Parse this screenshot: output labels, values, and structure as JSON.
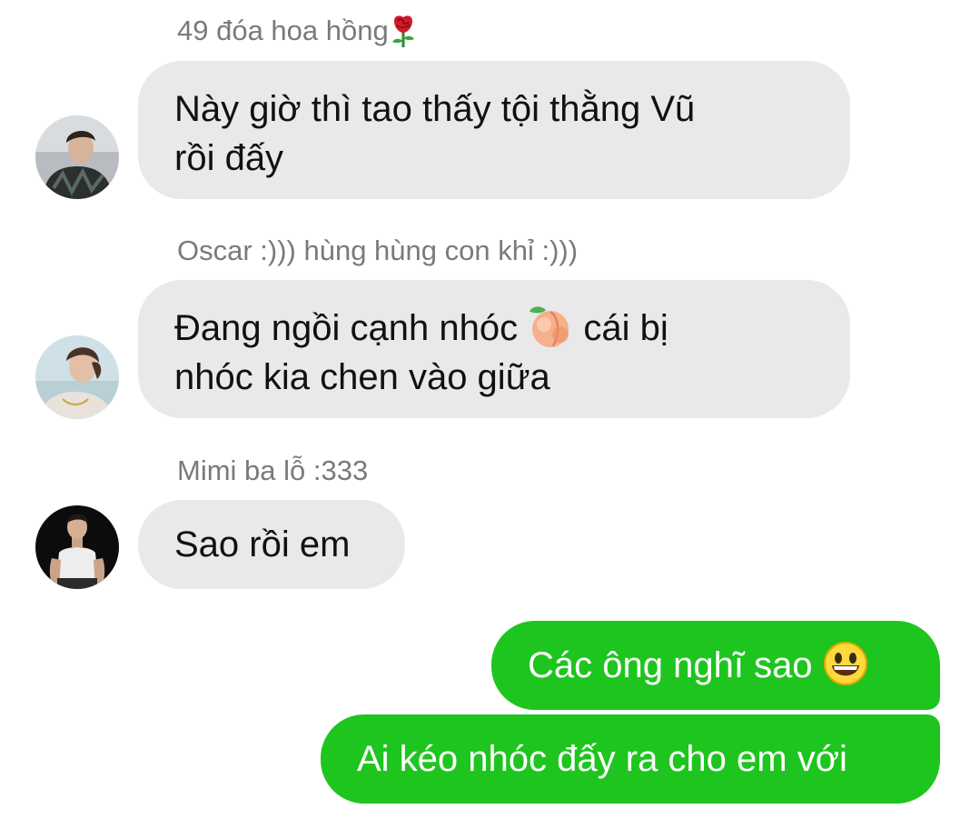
{
  "conversation": {
    "messages": [
      {
        "sender": "49 đóa hoa hồng",
        "sender_icon": "rose-emoji",
        "line1": "Này giờ thì tao thấy tội thằng Vũ",
        "line2": "rồi đấy"
      },
      {
        "sender": "Oscar :))) hùng hùng con khỉ :)))",
        "line1_before": "Đang ngồi cạnh nhóc",
        "line1_icon": "peach-emoji",
        "line1_after": "cái bị",
        "line2": "nhóc kia chen vào giữa"
      },
      {
        "sender": "Mimi ba lỗ :333",
        "text": "Sao rồi em"
      }
    ],
    "outgoing": [
      {
        "text": "Các ông nghĩ sao",
        "icon": "grinning-face-emoji"
      },
      {
        "text": "Ai kéo nhóc đấy ra cho em với"
      }
    ]
  },
  "colors": {
    "incoming_bubble": "#e9e9eb",
    "outgoing_bubble": "#1ec51e",
    "sender_name": "#7a7a7a"
  }
}
